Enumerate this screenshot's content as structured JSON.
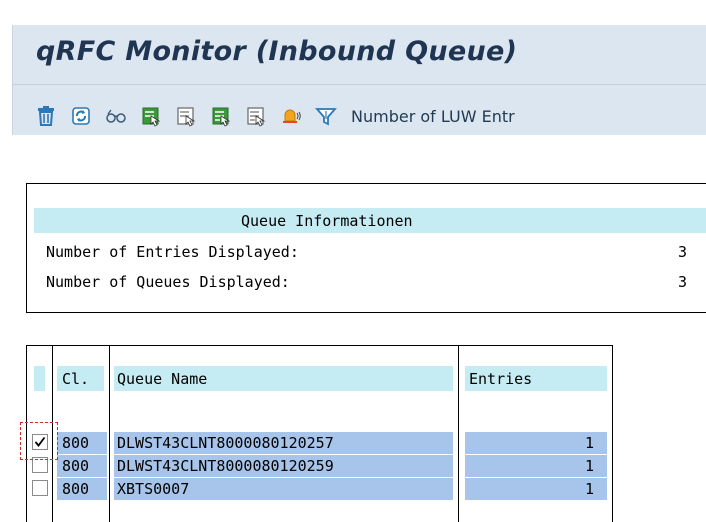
{
  "window": {
    "title": "qRFC Monitor (Inbound Queue)"
  },
  "toolbar": {
    "icons": [
      "delete-icon",
      "refresh-icon",
      "glasses-icon",
      "select-all-icon",
      "deselect-all-icon",
      "select-block-icon",
      "deselect-block-icon",
      "alert-bell-icon",
      "filter-icon"
    ],
    "luw_label": "Number of LUW Entr"
  },
  "info": {
    "header": "Queue Informationen",
    "rows": [
      {
        "label": "Number of Entries Displayed:",
        "value": "3"
      },
      {
        "label": "Number of Queues Displayed:",
        "value": "3"
      }
    ]
  },
  "table": {
    "headers": {
      "client": "Cl.",
      "queue_name": "Queue Name",
      "entries": "Entries"
    },
    "rows": [
      {
        "checked": true,
        "client": "800",
        "queue_name": "DLWST43CLNT8000080120257",
        "entries": "1"
      },
      {
        "checked": false,
        "client": "800",
        "queue_name": "DLWST43CLNT8000080120259",
        "entries": "1"
      },
      {
        "checked": false,
        "client": "800",
        "queue_name": "XBTS0007",
        "entries": "1"
      }
    ]
  },
  "colors": {
    "header_bg": "#dce6f0",
    "title_text": "#1f3552",
    "cyan_header": "#c6ecf3",
    "row_selected": "#a7c4ea",
    "focus_marker": "#d12b2b"
  }
}
